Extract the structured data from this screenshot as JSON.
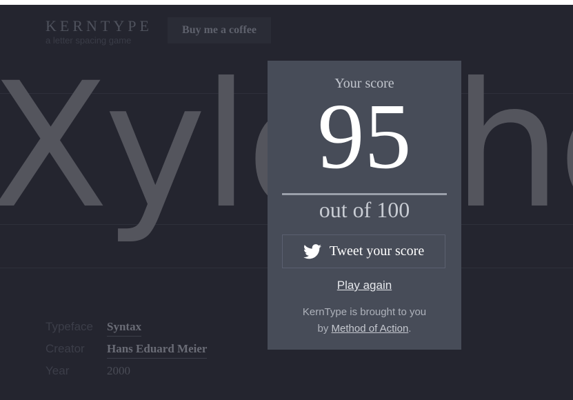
{
  "header": {
    "brand": "KERNTYPE",
    "tagline": "a letter spacing game",
    "coffee_button": "Buy me a coffee"
  },
  "game": {
    "word": "Xylophone",
    "meta": [
      {
        "label": "Typeface",
        "value": "Syntax"
      },
      {
        "label": "Creator",
        "value": "Hans Eduard Meier"
      },
      {
        "label": "Year",
        "value": "2000"
      }
    ]
  },
  "modal": {
    "score_label": "Your score",
    "score": "95",
    "out_of": "out of 100",
    "tweet_button": "Tweet your score",
    "play_again": "Play again",
    "credit_line1": "KernType is brought to you",
    "credit_by": "by",
    "credit_link": "Method of Action",
    "credit_end": "."
  },
  "colors": {
    "background": "#24252f",
    "modal": "#474c58",
    "accent_text": "#ffffff"
  },
  "icons": {
    "tweet": "twitter-bird-icon"
  }
}
